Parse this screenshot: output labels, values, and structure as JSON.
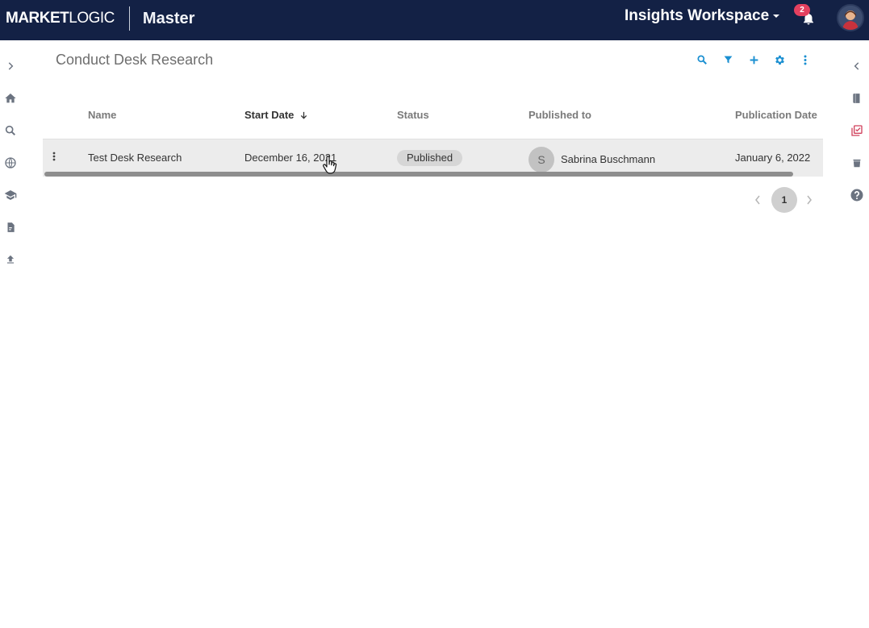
{
  "header": {
    "brand_bold": "MARKET",
    "brand_light": "LOGIC",
    "product": "Master",
    "workspace": "Insights Workspace",
    "notification_count": "2"
  },
  "page": {
    "title": "Conduct Desk Research"
  },
  "table": {
    "columns": [
      {
        "label": "Name"
      },
      {
        "label": "Start Date",
        "sorted": "descending"
      },
      {
        "label": "Status"
      },
      {
        "label": "Published to"
      },
      {
        "label": "Publication Date"
      }
    ],
    "rows": [
      {
        "name": "Test Desk Research",
        "start_date": "December 16, 2021",
        "status": "Published",
        "published_to_initial": "S",
        "published_to": "Sabrina Buschmann",
        "publication_date": "January 6, 2022"
      }
    ]
  },
  "pagination": {
    "current_page": "1"
  },
  "icons": {
    "left_rail": [
      "chevron-right-icon",
      "home-icon",
      "search-icon",
      "globe-icon",
      "graduation-cap-icon",
      "document-icon",
      "upload-icon"
    ],
    "right_rail": [
      "chevron-left-icon",
      "book-icon",
      "checklist-icon",
      "stack-icon",
      "help-icon"
    ],
    "toolbar": [
      "search-icon",
      "filter-icon",
      "add-icon",
      "settings-icon",
      "more-vertical-icon"
    ]
  },
  "colors": {
    "topbar": "#132145",
    "accent": "#1a8fd1",
    "badge": "#e4405f",
    "rail_icon": "#6b7380",
    "checklist_icon": "#d0415c"
  }
}
